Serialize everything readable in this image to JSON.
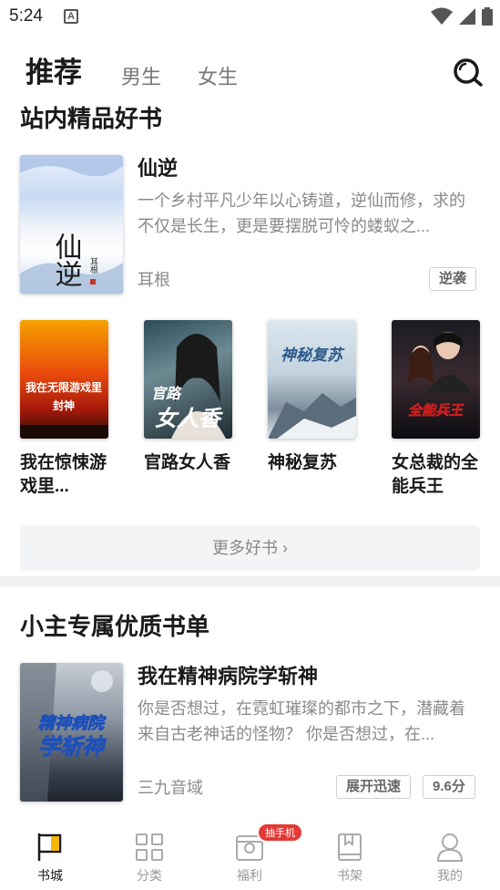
{
  "status_bar": {
    "time": "5:24",
    "notification_letter": "A"
  },
  "header": {
    "tabs": [
      {
        "label": "推荐",
        "active": true
      },
      {
        "label": "男生",
        "active": false
      },
      {
        "label": "女生",
        "active": false
      }
    ],
    "search_icon": "search-icon"
  },
  "section1": {
    "title": "站内精品好书",
    "featured": {
      "title": "仙逆",
      "description": "一个乡村平凡少年以心铸道，逆仙而修，求的不仅是长生，更是要摆脱可怜的蝼蚁之...",
      "author": "耳根",
      "tag": "逆袭",
      "cover_text": "仙逆",
      "cover_author": "耳根"
    },
    "grid": [
      {
        "title": "我在惊悚游戏里...",
        "cover_text": "我在无限游戏里",
        "cover_text2": "封神"
      },
      {
        "title": "官路女人香",
        "cover_text": "官路",
        "cover_text2": "女人香"
      },
      {
        "title": "神秘复苏",
        "cover_text": "神秘复苏"
      },
      {
        "title": "女总裁的全能兵王",
        "cover_text": "全能兵王"
      }
    ],
    "more_label": "更多好书 ›"
  },
  "section2": {
    "title": "小主专属优质书单",
    "book": {
      "title": "我在精神病院学斩神",
      "description": "你是否想过，在霓虹璀璨的都市之下，潜藏着来自古老神话的怪物？ 你是否想过，在...",
      "author": "三九音域",
      "tags": [
        "展开迅速",
        "9.6分"
      ],
      "cover_text": "精神病院",
      "cover_text2": "学斩神"
    }
  },
  "bottom_nav": {
    "items": [
      {
        "label": "书城",
        "icon": "flag-icon",
        "active": true
      },
      {
        "label": "分类",
        "icon": "grid-icon",
        "active": false
      },
      {
        "label": "福利",
        "icon": "gift-icon",
        "active": false,
        "badge": "抽手机"
      },
      {
        "label": "书架",
        "icon": "bookshelf-icon",
        "active": false
      },
      {
        "label": "我的",
        "icon": "person-icon",
        "active": false
      }
    ]
  },
  "colors": {
    "accent": "#e53935",
    "text": "#1a1a1a",
    "muted": "#8a8a8a"
  }
}
